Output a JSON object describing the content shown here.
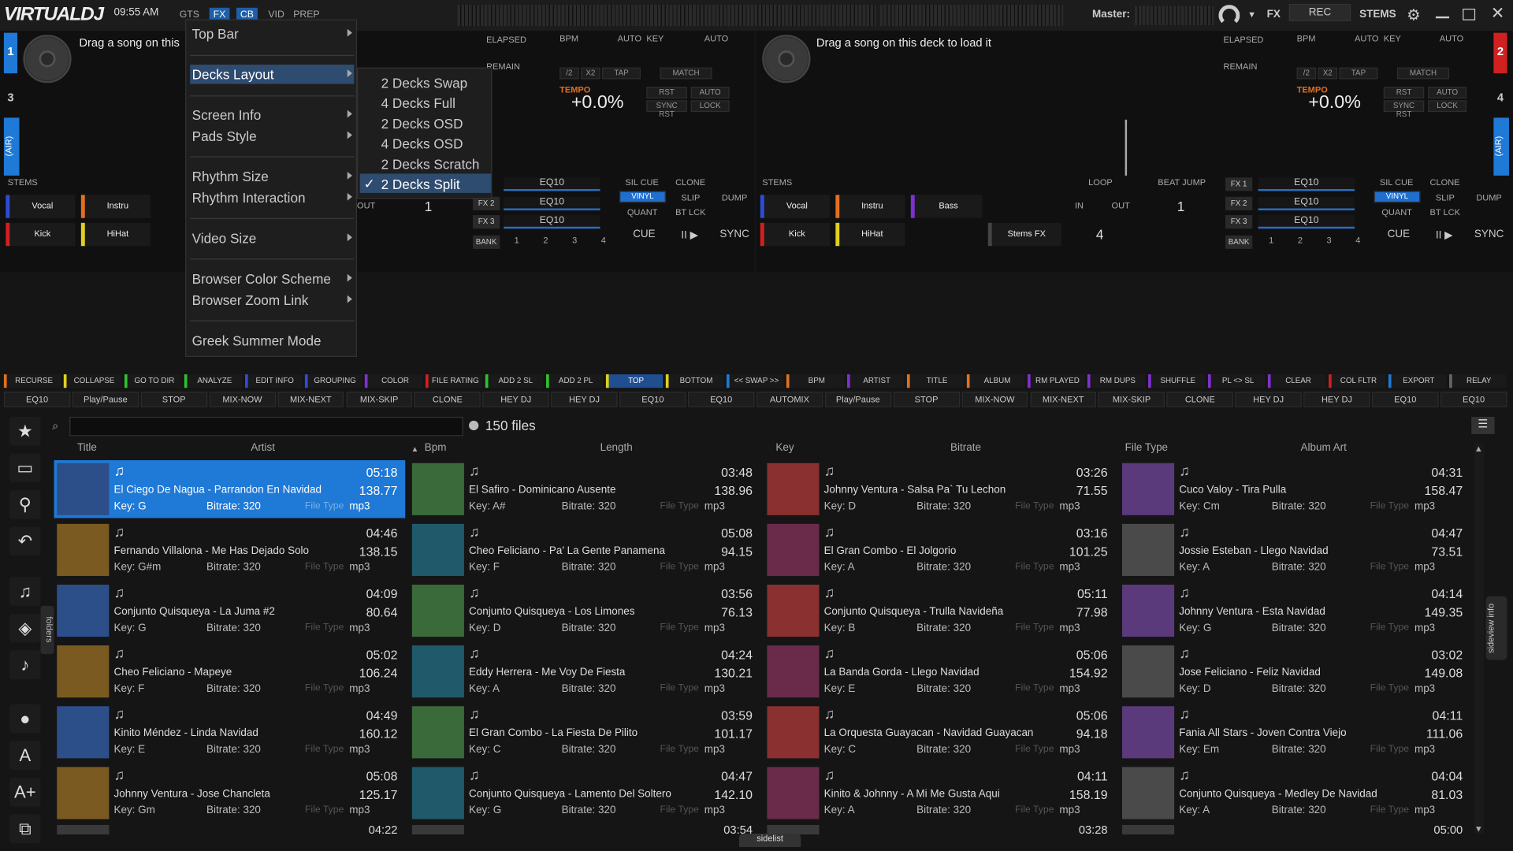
{
  "topbar": {
    "logo": "VIRTUALDJ",
    "clock": "09:55 AM",
    "tabs": [
      "GTS",
      "FX",
      "CB",
      "VID",
      "PREP"
    ],
    "master_label": "Master:",
    "fx": "FX",
    "rec": "REC",
    "stems": "STEMS"
  },
  "deck_left": {
    "num": "1",
    "num2": "3",
    "prompt": "Drag a song on this",
    "elapsed": "ELAPSED",
    "remain": "REMAIN",
    "bpm": "BPM",
    "auto": "AUTO",
    "key": "KEY",
    "auto2": "AUTO",
    "b1": "/2",
    "b2": "X2",
    "tap": "TAP",
    "match": "MATCH",
    "tempo": "TEMPO",
    "tempo_val": "+0.0%",
    "rst": "RST",
    "auto3": "AUTO",
    "syncrst": "SYNC RST",
    "lock": "LOCK",
    "stems": "STEMS",
    "pads": [
      "Vocal",
      "Instru",
      "Kick",
      "HiHat"
    ],
    "air": "(AIR)"
  },
  "deck_right": {
    "num": "2",
    "num2": "4",
    "prompt": "Drag a song on this deck to load it",
    "elapsed": "ELAPSED",
    "remain": "REMAIN",
    "bpm": "BPM",
    "auto": "AUTO",
    "key": "KEY",
    "auto2": "AUTO",
    "b1": "/2",
    "b2": "X2",
    "tap": "TAP",
    "match": "MATCH",
    "tempo": "TEMPO",
    "tempo_val": "+0.0%",
    "rst": "RST",
    "auto3": "AUTO",
    "syncrst": "SYNC RST",
    "lock": "LOCK",
    "stems": "STEMS",
    "pads": [
      "Vocal",
      "Instru",
      "Bass",
      "Kick",
      "HiHat",
      "Stems FX"
    ],
    "air": "(AIR)",
    "loop": "LOOP",
    "beatjump": "BEAT JUMP",
    "in": "IN",
    "out": "OUT",
    "loopval": "1",
    "jumpval": "4"
  },
  "deck_controls": {
    "fx": [
      "FX 1",
      "FX 2",
      "FX 3"
    ],
    "eq": "EQ10",
    "silcue": "SIL CUE",
    "clone": "CLONE",
    "vinyl": "VINYL",
    "slip": "SLIP",
    "dump": "DUMP",
    "quant": "QUANT",
    "btlck": "BT LCK",
    "cue": "CUE",
    "play": "II ▶",
    "sync": "SYNC",
    "bank": "BANK",
    "banks": [
      "1",
      "2",
      "3",
      "4"
    ],
    "out": "OUT",
    "one": "1"
  },
  "menu": {
    "items": [
      "Top Bar",
      "Decks Layout",
      "Screen Info",
      "Pads Style",
      "Rhythm Size",
      "Rhythm Interaction",
      "Video Size",
      "Browser Color Scheme",
      "Browser Zoom Link",
      "Greek Summer Mode"
    ]
  },
  "submenu": {
    "items": [
      "2 Decks Swap",
      "4 Decks Full",
      "2 Decks OSD",
      "4 Decks OSD",
      "2 Decks Scratch",
      "2 Decks Split"
    ],
    "check": "✓"
  },
  "toolbar1": [
    "RECURSE",
    "COLLAPSE",
    "GO TO DIR",
    "ANALYZE",
    "EDIT INFO",
    "GROUPING",
    "COLOR",
    "FILE RATING",
    "ADD 2 SL",
    "ADD 2 PL",
    "TOP",
    "BOTTOM",
    "<< SWAP >>",
    "BPM",
    "ARTIST",
    "TITLE",
    "ALBUM",
    "RM PLAYED",
    "RM DUPS",
    "SHUFFLE",
    "PL <> SL",
    "CLEAR",
    "COL FLTR",
    "EXPORT",
    "RELAY"
  ],
  "toolbar2": [
    "EQ10",
    "Play/Pause",
    "STOP",
    "MIX-NOW",
    "MIX-NEXT",
    "MIX-SKIP",
    "CLONE",
    "HEY DJ",
    "HEY DJ",
    "EQ10",
    "EQ10",
    "AUTOMIX",
    "Play/Pause",
    "STOP",
    "MIX-NOW",
    "MIX-NEXT",
    "MIX-SKIP",
    "CLONE",
    "HEY DJ",
    "HEY DJ",
    "EQ10",
    "EQ10"
  ],
  "browser": {
    "count": "150 files",
    "cols": [
      "Title",
      "Artist",
      "Bpm",
      "Length",
      "Key",
      "Bitrate",
      "File Type",
      "Album Art"
    ],
    "folders": "folders",
    "sideview": "sideview",
    "info": "info",
    "sidelist": "sidelist",
    "key_lbl": "Key:",
    "bit_lbl": "Bitrate:",
    "ft_lbl": "File Type"
  },
  "tracks": [
    [
      {
        "t": "04:46",
        "b": "138.15",
        "n": "Fernando Villalona - Me Has Dejado Solo",
        "k": "G#m"
      },
      {
        "t": "05:08",
        "b": "94.15",
        "n": "Cheo Feliciano - Pa' La Gente Panamena",
        "k": "F"
      },
      {
        "t": "03:16",
        "b": "101.25",
        "n": "El Gran Combo - El Jolgorio",
        "k": "A"
      },
      {
        "t": "04:47",
        "b": "73.51",
        "n": "Jossie Esteban - Llego Navidad",
        "k": "A"
      }
    ],
    [
      {
        "t": "04:09",
        "b": "80.64",
        "n": "Conjunto Quisqueya - La Juma #2",
        "k": "G"
      },
      {
        "t": "03:56",
        "b": "76.13",
        "n": "Conjunto Quisqueya - Los Limones",
        "k": "D"
      },
      {
        "t": "05:11",
        "b": "77.98",
        "n": "Conjunto Quisqueya - Trulla Navideña",
        "k": "B"
      },
      {
        "t": "04:14",
        "b": "149.35",
        "n": "Johnny Ventura - Esta Navidad",
        "k": "G"
      }
    ],
    [
      {
        "t": "05:02",
        "b": "106.24",
        "n": "Cheo Feliciano - Mapeye",
        "k": "F"
      },
      {
        "t": "04:24",
        "b": "130.21",
        "n": "Eddy Herrera - Me Voy De Fiesta",
        "k": "A"
      },
      {
        "t": "05:06",
        "b": "154.92",
        "n": "La Banda Gorda - Llego Navidad",
        "k": "E"
      },
      {
        "t": "03:02",
        "b": "149.08",
        "n": "Jose Feliciano - Feliz Navidad",
        "k": "D"
      }
    ],
    [
      {
        "t": "04:49",
        "b": "160.12",
        "n": "Kinito Méndez - Linda Navidad",
        "k": "E"
      },
      {
        "t": "03:59",
        "b": "101.17",
        "n": "El Gran Combo - La Fiesta De Pilito",
        "k": "C"
      },
      {
        "t": "05:06",
        "b": "94.18",
        "n": "La Orquesta Guayacan - Navidad Guayacan",
        "k": "C"
      },
      {
        "t": "04:11",
        "b": "111.06",
        "n": "Fania All Stars - Joven Contra Viejo",
        "k": "Em"
      }
    ],
    [
      {
        "t": "05:08",
        "b": "125.17",
        "n": "Johnny Ventura - Jose Chancleta",
        "k": "Gm"
      },
      {
        "t": "04:47",
        "b": "142.10",
        "n": "Conjunto Quisqueya - Lamento Del Soltero",
        "k": "G"
      },
      {
        "t": "04:11",
        "b": "158.19",
        "n": "Kinito & Johnny - A Mi Me Gusta Aqui",
        "k": "A"
      },
      {
        "t": "04:04",
        "b": "81.03",
        "n": "Conjunto Quisqueya - Medley De Navidad",
        "k": "A"
      }
    ]
  ],
  "row0": [
    {
      "t": "05:18",
      "b": "138.77",
      "n": "El Ciego De Nagua - Parrandon En Navidad",
      "k": "G"
    },
    {
      "t": "03:48",
      "b": "138.96",
      "n": "El Safiro - Dominicano Ausente",
      "k": "A#"
    },
    {
      "t": "03:26",
      "b": "71.55",
      "n": "Johnny Ventura - Salsa Pa` Tu Lechon",
      "k": "D"
    },
    {
      "t": "04:31",
      "b": "158.47",
      "n": "Cuco Valoy - Tira Pulla",
      "k": "Cm"
    }
  ],
  "bitrate": "320",
  "ext": "mp3",
  "partial": [
    "04:22",
    "03:54",
    "03:28",
    "05:00"
  ],
  "colors": {
    "accent": "#1f79d6",
    "orange": "#e07020",
    "menu_hl": "#2e4b70"
  }
}
